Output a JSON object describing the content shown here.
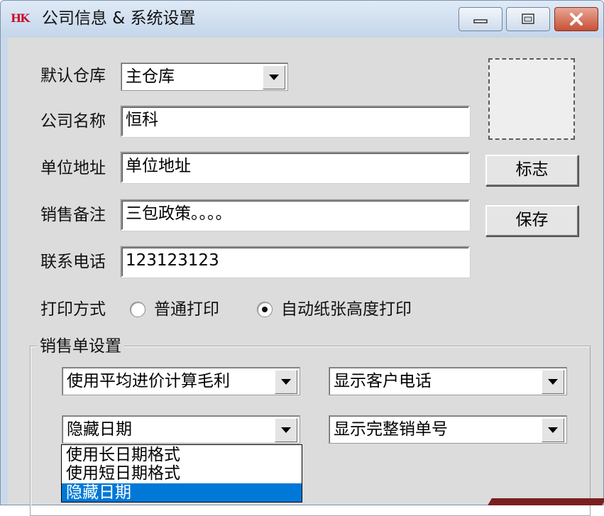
{
  "window": {
    "title": "公司信息 & 系统设置",
    "logo_text": "HK"
  },
  "form": {
    "warehouse_label": "默认仓库",
    "warehouse_value": "主仓库",
    "company_label": "公司名称",
    "company_value": "恒科",
    "address_label": "单位地址",
    "address_value": "单位地址",
    "note_label": "销售备注",
    "note_value": "三包政策。。。。",
    "phone_label": "联系电话",
    "phone_value": "123123123"
  },
  "buttons": {
    "logo": "标志",
    "save": "保存"
  },
  "print": {
    "label": "打印方式",
    "option_normal": "普通打印",
    "option_auto": "自动纸张高度打印",
    "selected": "auto"
  },
  "sales": {
    "group_title": "销售单设置",
    "profit_value": "使用平均进价计算毛利",
    "customer_phone_value": "显示客户电话",
    "date_value": "隐藏日期",
    "order_no_value": "显示完整销单号",
    "date_options": [
      "使用长日期格式",
      "使用短日期格式",
      "隐藏日期"
    ],
    "date_selected_index": 2
  },
  "colors": {
    "selection": "#0078d7",
    "close_button": "#c75035",
    "logo_red": "#c8102e"
  }
}
